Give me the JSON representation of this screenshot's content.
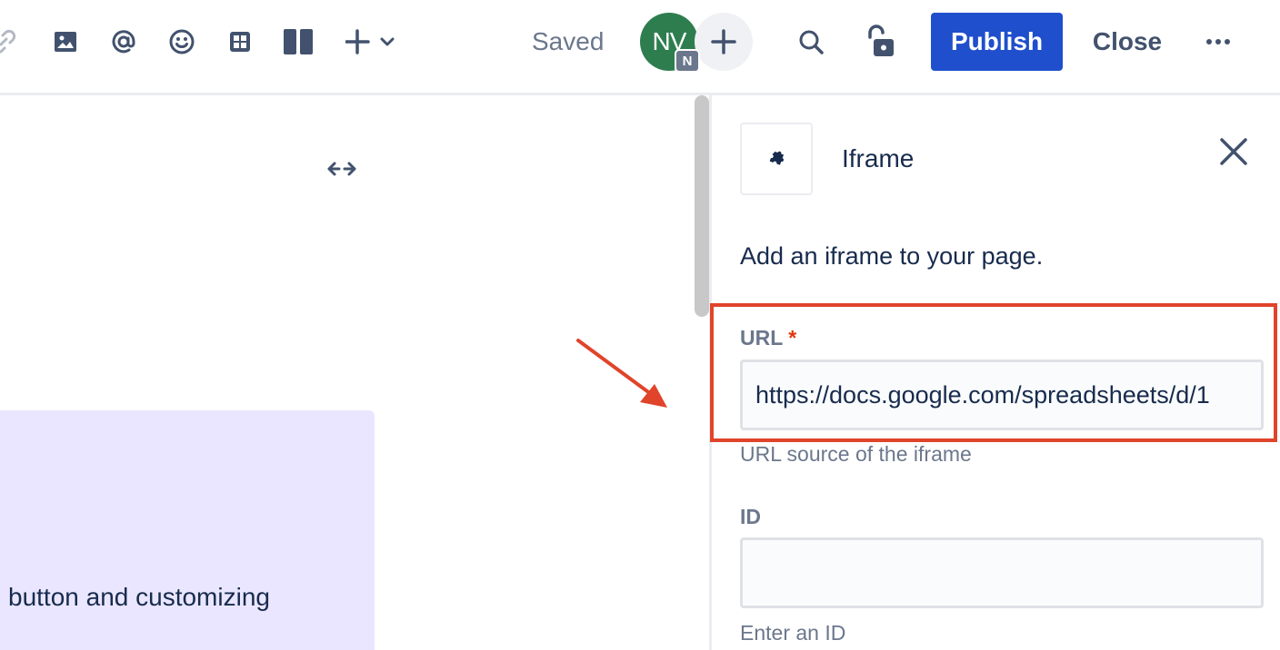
{
  "toolbar": {
    "icons": [
      "link-icon",
      "image-icon",
      "mention-icon",
      "emoji-icon",
      "table-icon",
      "layouts-icon",
      "insert-more-icon"
    ],
    "saved_status": "Saved",
    "avatar_initials": "NV",
    "avatar_badge": "N",
    "publish_label": "Publish",
    "close_label": "Close"
  },
  "editor": {
    "panel_text": "button and customizing"
  },
  "side_panel": {
    "macro_title": "Iframe",
    "description": "Add an iframe to your page.",
    "url_field": {
      "label": "URL",
      "required_marker": "*",
      "value": "https://docs.google.com/spreadsheets/d/1",
      "help": "URL source of the iframe"
    },
    "id_field": {
      "label": "ID",
      "value": "",
      "help": "Enter an ID"
    }
  },
  "colors": {
    "publish": "#1f4fcc",
    "avatar": "#2e7d4f",
    "highlight": "#e0442a",
    "panel_background": "#eae6ff"
  }
}
